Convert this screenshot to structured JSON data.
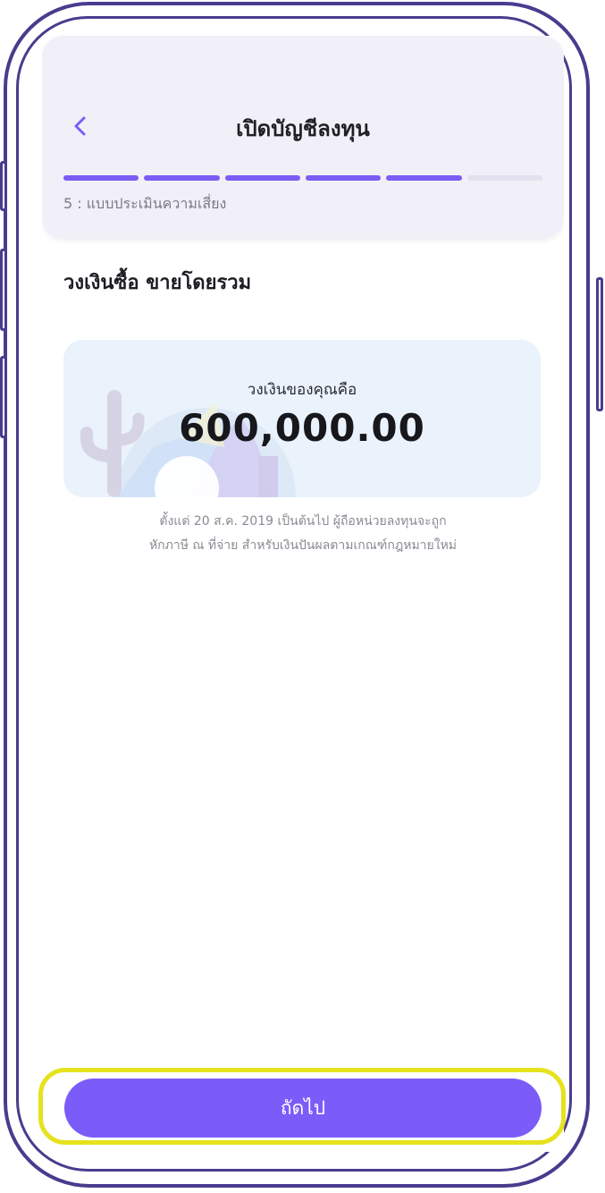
{
  "header": {
    "title": "เปิดบัญชีลงทุน",
    "back_icon": "chevron-left-icon",
    "progress": {
      "total_steps": 6,
      "completed_steps": 5
    },
    "step_label": "5 : แบบประเมินความเสี่ยง"
  },
  "content": {
    "section_title": "วงเงินซื้อ ขายโดยรวม",
    "limit_card": {
      "caption": "วงเงินของคุณคือ",
      "amount": "600,000.00"
    },
    "disclaimer_line1": "ตั้งแต่ 20 ส.ค. 2019 เป็นต้นไป ผู้ถือหน่วยลงทุนจะถูก",
    "disclaimer_line2": "หักภาษี ณ ที่จ่าย สำหรับเงินปันผลตามเกณฑ์กฎหมายใหม่"
  },
  "footer": {
    "next_label": "ถัดไป"
  },
  "colors": {
    "accent": "#7b5cf9",
    "frame": "#4b3b8e",
    "highlight": "#e6e21e",
    "header_bg": "#f1eff8",
    "card_bg": "#eaf2fb"
  }
}
